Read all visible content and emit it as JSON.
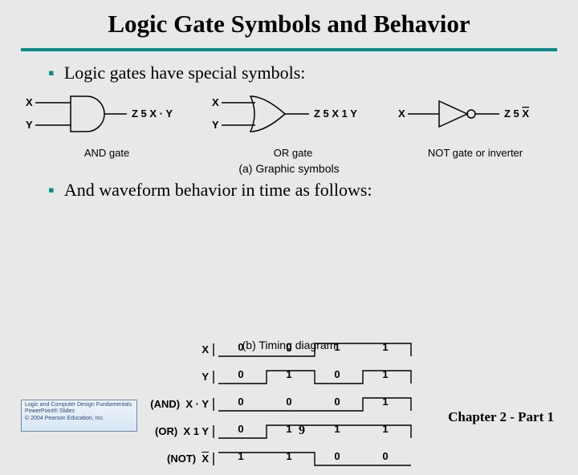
{
  "title": "Logic Gate Symbols and Behavior",
  "bullets": {
    "b1": "Logic gates have special symbols:",
    "b2": "And waveform behavior in time as follows:"
  },
  "gates": {
    "and": {
      "in1": "X",
      "in2": "Y",
      "out": "Z 5 X · Y",
      "label": "AND gate"
    },
    "or": {
      "in1": "X",
      "in2": "Y",
      "out": "Z 5 X 1 Y",
      "label": "OR gate"
    },
    "not": {
      "in": "X",
      "out_prefix": "Z 5 ",
      "out_bar": "X",
      "label": "NOT gate or inverter"
    }
  },
  "captions": {
    "a": "(a) Graphic symbols",
    "b": "(b) Timing diagram"
  },
  "waveforms": [
    {
      "label_prefix": "",
      "label_main": "X",
      "vals": [
        "0",
        "0",
        "1",
        "1"
      ]
    },
    {
      "label_prefix": "",
      "label_main": "Y",
      "vals": [
        "0",
        "1",
        "0",
        "1"
      ]
    },
    {
      "label_prefix": "(AND)",
      "label_main": "X · Y",
      "vals": [
        "0",
        "0",
        "0",
        "1"
      ]
    },
    {
      "label_prefix": "(OR)",
      "label_main": "X 1 Y",
      "vals": [
        "0",
        "1",
        "1",
        "1"
      ]
    },
    {
      "label_prefix": "(NOT)",
      "label_main": "X",
      "bar": true,
      "vals": [
        "1",
        "1",
        "0",
        "0"
      ]
    }
  ],
  "footer": {
    "chapter": "Chapter 2 - Part 1",
    "page": "9",
    "logo_l1": "Logic and Computer Design Fundamentals",
    "logo_l2": "PowerPoint® Slides",
    "logo_l3": "© 2004 Pearson Education, Inc."
  }
}
